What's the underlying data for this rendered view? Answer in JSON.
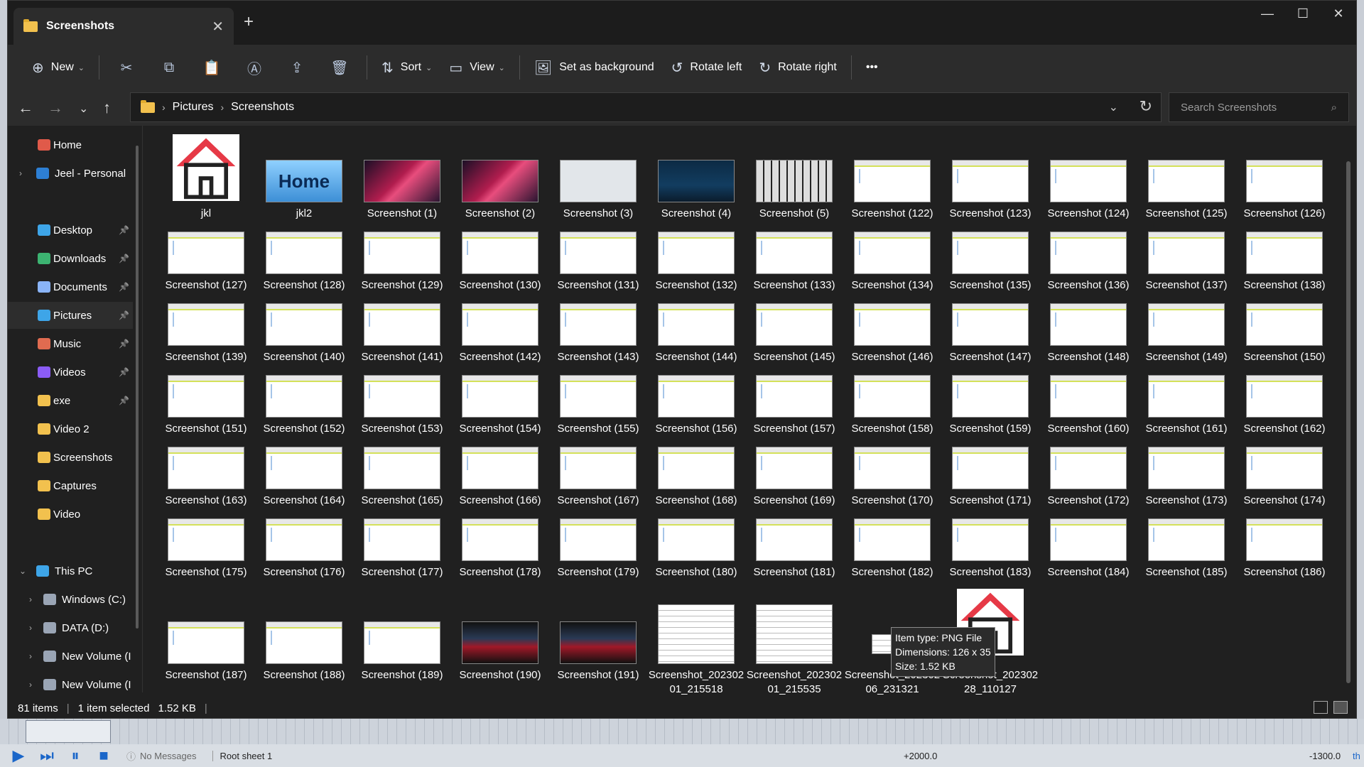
{
  "window": {
    "tab_title": "Screenshots"
  },
  "toolbar": {
    "new": "New",
    "sort": "Sort",
    "view": "View",
    "set_bg": "Set as background",
    "rotate_left": "Rotate left",
    "rotate_right": "Rotate right",
    "more": "•••"
  },
  "address": {
    "crumbs": [
      "Pictures",
      "Screenshots"
    ],
    "search_placeholder": "Search Screenshots"
  },
  "sidebar": [
    {
      "label": "Home",
      "icon": "home-icon"
    },
    {
      "label": "Jeel - Personal",
      "icon": "cloud-icon"
    },
    {
      "label": "Desktop",
      "icon": "desktop-icon",
      "pin": true
    },
    {
      "label": "Downloads",
      "icon": "download-icon",
      "pin": true
    },
    {
      "label": "Documents",
      "icon": "documents-icon",
      "pin": true
    },
    {
      "label": "Pictures",
      "icon": "pictures-icon",
      "pin": true
    },
    {
      "label": "Music",
      "icon": "music-icon",
      "pin": true
    },
    {
      "label": "Videos",
      "icon": "videos-icon",
      "pin": true
    },
    {
      "label": "exe",
      "icon": "folder-icon",
      "pin": true
    },
    {
      "label": "Video 2",
      "icon": "folder-icon"
    },
    {
      "label": "Screenshots",
      "icon": "folder-icon"
    },
    {
      "label": "Captures",
      "icon": "folder-icon"
    },
    {
      "label": "Video",
      "icon": "folder-icon"
    },
    {
      "label": "This PC",
      "icon": "pc-icon"
    },
    {
      "label": "Windows (C:)",
      "icon": "drive-icon"
    },
    {
      "label": "DATA (D:)",
      "icon": "drive-icon"
    },
    {
      "label": "New Volume (I",
      "icon": "drive-icon"
    },
    {
      "label": "New Volume (I",
      "icon": "drive-icon"
    }
  ],
  "files": [
    "jkl",
    "jkl2",
    "Screenshot (1)",
    "Screenshot (2)",
    "Screenshot (3)",
    "Screenshot (4)",
    "Screenshot (5)",
    "Screenshot (122)",
    "Screenshot (123)",
    "Screenshot (124)",
    "Screenshot (125)",
    "Screenshot (126)",
    "Screenshot (127)",
    "Screenshot (128)",
    "Screenshot (129)",
    "Screenshot (130)",
    "Screenshot (131)",
    "Screenshot (132)",
    "Screenshot (133)",
    "Screenshot (134)",
    "Screenshot (135)",
    "Screenshot (136)",
    "Screenshot (137)",
    "Screenshot (138)",
    "Screenshot (139)",
    "Screenshot (140)",
    "Screenshot (141)",
    "Screenshot (142)",
    "Screenshot (143)",
    "Screenshot (144)",
    "Screenshot (145)",
    "Screenshot (146)",
    "Screenshot (147)",
    "Screenshot (148)",
    "Screenshot (149)",
    "Screenshot (150)",
    "Screenshot (151)",
    "Screenshot (152)",
    "Screenshot (153)",
    "Screenshot (154)",
    "Screenshot (155)",
    "Screenshot (156)",
    "Screenshot (157)",
    "Screenshot (158)",
    "Screenshot (159)",
    "Screenshot (160)",
    "Screenshot (161)",
    "Screenshot (162)",
    "Screenshot (163)",
    "Screenshot (164)",
    "Screenshot (165)",
    "Screenshot (166)",
    "Screenshot (167)",
    "Screenshot (168)",
    "Screenshot (169)",
    "Screenshot (170)",
    "Screenshot (171)",
    "Screenshot (172)",
    "Screenshot (173)",
    "Screenshot (174)",
    "Screenshot (175)",
    "Screenshot (176)",
    "Screenshot (177)",
    "Screenshot (178)",
    "Screenshot (179)",
    "Screenshot (180)",
    "Screenshot (181)",
    "Screenshot (182)",
    "Screenshot (183)",
    "Screenshot (184)",
    "Screenshot (185)",
    "Screenshot (186)",
    "Screenshot (187)",
    "Screenshot (188)",
    "Screenshot (189)",
    "Screenshot (190)",
    "Screenshot (191)",
    "Screenshot_20230201_215518",
    "Screenshot_20230201_215535",
    "Screenshot_20230206_231321",
    "Screenshot_20230228_110127"
  ],
  "tooltip": {
    "type": "Item type: PNG File",
    "dims": "Dimensions: 126 x 35",
    "size": "Size: 1.52 KB"
  },
  "status": {
    "count": "81 items",
    "selected": "1 item selected",
    "size": "1.52 KB"
  },
  "bottom": {
    "messages": "No Messages",
    "sheet": "Root sheet 1",
    "coord1": "+2000.0",
    "coord2": "-1300.0",
    "edge": "th"
  }
}
